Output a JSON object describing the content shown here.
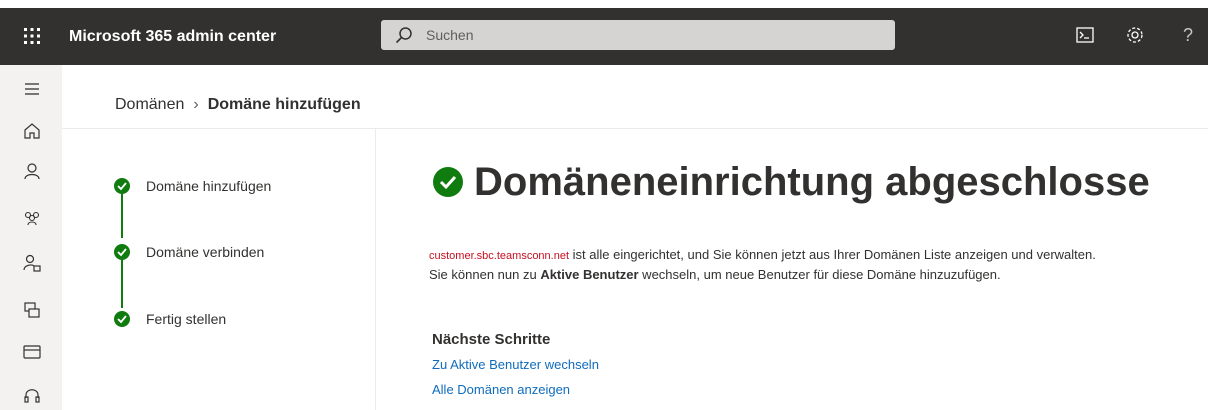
{
  "header": {
    "app_title": "Microsoft 365 admin center",
    "search_placeholder": "Suchen",
    "help_label": "?"
  },
  "icons": {
    "waffle": "app-launcher-icon",
    "search": "search-icon",
    "terminal": "terminal-icon",
    "settings": "gear-icon",
    "help": "help-icon"
  },
  "sidebar": {
    "items": [
      {
        "icon": "hamburger-menu-icon"
      },
      {
        "icon": "home-icon"
      },
      {
        "icon": "user-icon"
      },
      {
        "icon": "group-icon"
      },
      {
        "icon": "user-license-icon"
      },
      {
        "icon": "devices-icon"
      },
      {
        "icon": "billing-card-icon"
      },
      {
        "icon": "headset-icon"
      }
    ]
  },
  "breadcrumb": {
    "parent": "Domänen",
    "separator": "›",
    "current": "Domäne hinzufügen"
  },
  "steps": [
    {
      "label": "Domäne hinzufügen",
      "status": "complete"
    },
    {
      "label": "Domäne verbinden",
      "status": "complete"
    },
    {
      "label": "Fertig stellen",
      "status": "complete"
    }
  ],
  "main": {
    "heading": "Domäneneinrichtung abgeschlosse",
    "domain": "customer.sbc.teamsconn.net",
    "line1_rest": " ist alle eingerichtet, und Sie können jetzt aus Ihrer Domänen Liste anzeigen und verwalten.",
    "line2_prefix": "Sie können nun zu ",
    "line2_bold": "Aktive Benutzer",
    "line2_suffix": " wechseln, um neue Benutzer für diese Domäne hinzuzufügen.",
    "next_steps_title": "Nächste Schritte",
    "links": [
      "Zu Aktive Benutzer wechseln",
      "Alle Domänen anzeigen"
    ]
  },
  "colors": {
    "topbar": "#323130",
    "success": "#107c10",
    "link": "#0f6cbd",
    "domain_text": "#c50f1f"
  }
}
